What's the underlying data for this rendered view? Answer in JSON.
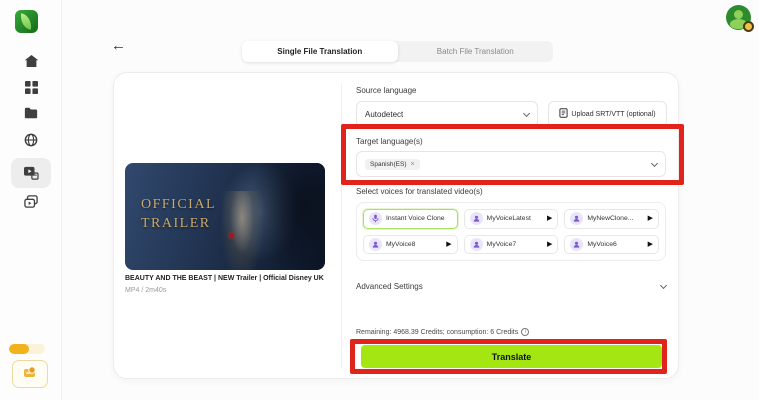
{
  "icons": {
    "back_arrow": "←",
    "play": "▶",
    "close": "×",
    "info": "i"
  },
  "header": {
    "tabs": [
      {
        "label": "Single File Translation",
        "active": true
      },
      {
        "label": "Batch File Translation",
        "active": false
      }
    ]
  },
  "video": {
    "poster_title_line1": "OFFICIAL",
    "poster_title_line2": "TRAILER",
    "title": "BEAUTY AND THE BEAST | NEW Trailer | Official Disney UK",
    "meta": "MP4 / 2m40s"
  },
  "form": {
    "source_language": {
      "label": "Source language",
      "value": "Autodetect"
    },
    "upload_button": {
      "label": "Upload SRT/VTT (optional)"
    },
    "target_language": {
      "label": "Target language(s)",
      "selected_tag": "Spanish(ES)"
    },
    "voices": {
      "label": "Select voices for translated video(s)",
      "options": [
        {
          "name": "Instant Voice Clone",
          "selected": true
        },
        {
          "name": "MyVoiceLatest"
        },
        {
          "name": "MyNewClone..."
        },
        {
          "name": "MyVoice8"
        },
        {
          "name": "MyVoice7"
        },
        {
          "name": "MyVoice6"
        }
      ]
    },
    "advanced_settings": {
      "label": "Advanced Settings"
    },
    "credits": {
      "text": "Remaining: 4968.39 Credits; consumption: 6 Credits"
    },
    "translate_button": {
      "label": "Translate"
    }
  },
  "colors": {
    "translate_green": "#a4e612",
    "annotation_red": "#e1241b",
    "voice_icon_purple": "#7a5bd0",
    "selected_chip_border": "#a9e163",
    "logo_green": "#116b16"
  }
}
